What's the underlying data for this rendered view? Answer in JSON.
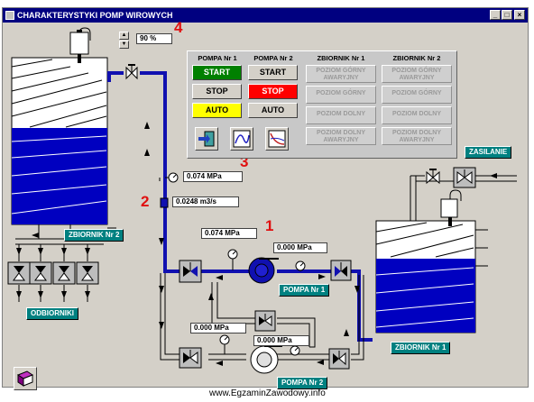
{
  "window": {
    "title": "CHARAKTERYSTYKI POMP WIROWYCH"
  },
  "spinner": {
    "value": "90 %"
  },
  "markers": [
    "1",
    "2",
    "3",
    "4"
  ],
  "readings": {
    "pressure_main": "0.074 MPa",
    "flow": "0.0248 m3/s",
    "pressure_pump1_in": "0.074 MPa",
    "pressure_pump1_out": "0.000 MPa",
    "pressure_pump2_in": "0.000 MPa",
    "pressure_pump2_out": "0.000 MPa"
  },
  "labels": {
    "tank2": "ZBIORNIK Nr 2",
    "tank1": "ZBIORNIK Nr 1",
    "consumers": "ODBIORNIKI",
    "supply": "ZASILANIE",
    "pump1": "POMPA Nr 1",
    "pump2": "POMPA Nr 2"
  },
  "control_panel": {
    "pump1": {
      "header": "POMPA Nr 1",
      "start": "START",
      "stop": "STOP",
      "auto": "AUTO"
    },
    "pump2": {
      "header": "POMPA Nr 2",
      "start": "START",
      "stop": "STOP",
      "auto": "AUTO"
    },
    "tank1": {
      "header": "ZBIORNIK Nr 1",
      "emergency_top": "POZIOM GÓRNY AWARYJNY",
      "top": "POZIOM GÓRNY",
      "bottom": "POZIOM DOLNY",
      "emergency_bottom": "POZIOM DOLNY AWARYJNY"
    },
    "tank2": {
      "header": "ZBIORNIK Nr 2",
      "emergency_top": "POZIOM GÓRNY AWARYJNY",
      "top": "POZIOM GÓRNY",
      "bottom": "POZIOM DOLNY",
      "emergency_bottom": "POZIOM DOLNY AWARYJNY"
    },
    "icons": [
      "exit-icon",
      "pump-curve-icon",
      "characteristics-icon"
    ]
  },
  "colors": {
    "title_bar": "#000080",
    "water": "#0000c0",
    "pipe_active": "#1010b0",
    "label_bg": "#008080",
    "marker": "#e01010",
    "start_on": "#008000",
    "stop_on": "#ff0000",
    "auto_on": "#ffff00"
  },
  "watermark": "www.EgzaminZawodowy.info"
}
